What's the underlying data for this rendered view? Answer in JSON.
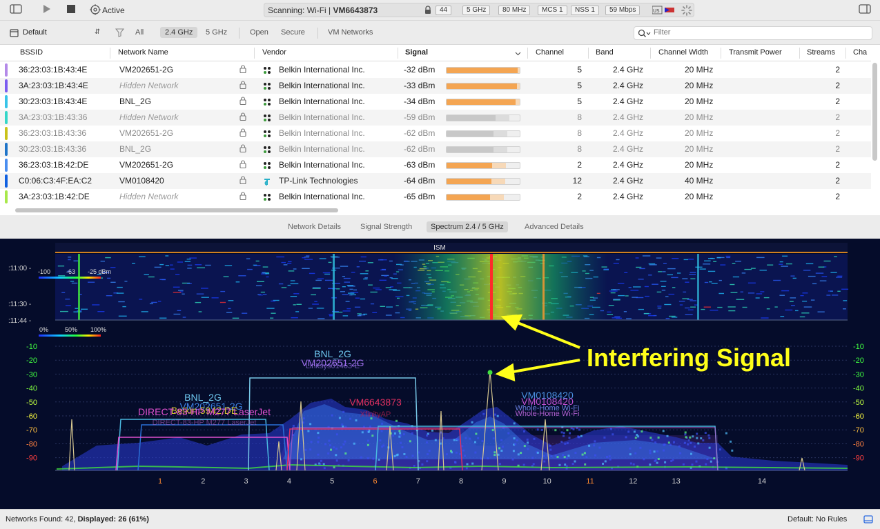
{
  "toolbar": {
    "status_label": "Active",
    "scan_prefix": "Scanning: Wi-Fi  |  ",
    "scan_network": "VM6643873",
    "pills": [
      "44",
      "5 GHz",
      "80 MHz",
      "MCS 1",
      "NSS 1",
      "59 Mbps"
    ]
  },
  "filterbar": {
    "profile": "Default",
    "filters": [
      "All",
      "2.4 GHz",
      "5 GHz",
      "Open",
      "Secure",
      "VM Networks"
    ],
    "selected_filter": "2.4 GHz",
    "search_placeholder": "Filter"
  },
  "table": {
    "columns": [
      "BSSID",
      "Network Name",
      "Vendor",
      "Signal",
      "Channel",
      "Band",
      "Channel Width",
      "Transmit Power",
      "Streams",
      "Cha"
    ],
    "rows": [
      {
        "tag_color": "#b48ae8",
        "bssid": "36:23:03:1B:43:4E",
        "name": "VM202651-2G",
        "hidden": false,
        "vendor": "Belkin International Inc.",
        "vendor_icon": "belkin-icon",
        "signal": "-32 dBm",
        "signal_pct": 95,
        "channel": "5",
        "band": "2.4 GHz",
        "width": "20 MHz",
        "streams": "2",
        "dim": false
      },
      {
        "tag_color": "#7b5cf0",
        "bssid": "3A:23:03:1B:43:4E",
        "name": "Hidden Network",
        "hidden": true,
        "vendor": "Belkin International Inc.",
        "vendor_icon": "belkin-icon",
        "signal": "-33 dBm",
        "signal_pct": 94,
        "channel": "5",
        "band": "2.4 GHz",
        "width": "20 MHz",
        "streams": "2",
        "dim": false
      },
      {
        "tag_color": "#38c4e8",
        "bssid": "30:23:03:1B:43:4E",
        "name": "BNL_2G",
        "hidden": false,
        "vendor": "Belkin International Inc.",
        "vendor_icon": "belkin-icon",
        "signal": "-34 dBm",
        "signal_pct": 93,
        "channel": "5",
        "band": "2.4 GHz",
        "width": "20 MHz",
        "streams": "2",
        "dim": false
      },
      {
        "tag_color": "#34d6c8",
        "bssid": "3A:23:03:1B:43:36",
        "name": "Hidden Network",
        "hidden": true,
        "vendor": "Belkin International Inc.",
        "vendor_icon": "belkin-icon",
        "signal": "-59 dBm",
        "signal_pct": 66,
        "channel": "8",
        "band": "2.4 GHz",
        "width": "20 MHz",
        "streams": "2",
        "dim": true
      },
      {
        "tag_color": "#c9c21a",
        "bssid": "36:23:03:1B:43:36",
        "name": "VM202651-2G",
        "hidden": false,
        "vendor": "Belkin International Inc.",
        "vendor_icon": "belkin-icon",
        "signal": "-62 dBm",
        "signal_pct": 63,
        "channel": "8",
        "band": "2.4 GHz",
        "width": "20 MHz",
        "streams": "2",
        "dim": true
      },
      {
        "tag_color": "#1e74c8",
        "bssid": "30:23:03:1B:43:36",
        "name": "BNL_2G",
        "hidden": false,
        "vendor": "Belkin International Inc.",
        "vendor_icon": "belkin-icon",
        "signal": "-62 dBm",
        "signal_pct": 63,
        "channel": "8",
        "band": "2.4 GHz",
        "width": "20 MHz",
        "streams": "2",
        "dim": true
      },
      {
        "tag_color": "#4a8ef0",
        "bssid": "36:23:03:1B:42:DE",
        "name": "VM202651-2G",
        "hidden": false,
        "vendor": "Belkin International Inc.",
        "vendor_icon": "belkin-icon",
        "signal": "-63 dBm",
        "signal_pct": 61,
        "channel": "2",
        "band": "2.4 GHz",
        "width": "20 MHz",
        "streams": "2",
        "dim": false
      },
      {
        "tag_color": "#1060e0",
        "bssid": "C0:06:C3:4F:EA:C2",
        "name": "VM0108420",
        "hidden": false,
        "vendor": "TP-Link Technologies",
        "vendor_icon": "tplink-icon",
        "signal": "-64 dBm",
        "signal_pct": 60,
        "channel": "12",
        "band": "2.4 GHz",
        "width": "40 MHz",
        "streams": "2",
        "dim": false
      },
      {
        "tag_color": "#a8e84a",
        "bssid": "3A:23:03:1B:42:DE",
        "name": "Hidden Network",
        "hidden": true,
        "vendor": "Belkin International Inc.",
        "vendor_icon": "belkin-icon",
        "signal": "-65 dBm",
        "signal_pct": 58,
        "channel": "2",
        "band": "2.4 GHz",
        "width": "20 MHz",
        "streams": "2",
        "dim": false
      }
    ]
  },
  "tabs": [
    "Network Details",
    "Signal Strength",
    "Spectrum 2.4 / 5 GHz",
    "Advanced Details"
  ],
  "selected_tab": "Spectrum 2.4 / 5 GHz",
  "spectrum": {
    "band_label": "ISM",
    "waterfall_times": [
      ":11:00 -",
      ":11:30 -",
      ":11:44 -"
    ],
    "dbm_legend": [
      "-100",
      "-63",
      "-25 dBm"
    ],
    "pct_legend": [
      "0%",
      "50%",
      "100%"
    ],
    "y_ticks": [
      "-10",
      "-20",
      "-30",
      "-40",
      "-50",
      "-60",
      "-70",
      "-80",
      "-90"
    ],
    "x_ticks": [
      "1",
      "2",
      "3",
      "4",
      "5",
      "6",
      "7",
      "8",
      "9",
      "10",
      "11",
      "12",
      "13",
      "14"
    ],
    "highlighted_channels": [
      "1",
      "6",
      "11"
    ],
    "network_labels": {
      "bnl_top": "BNL_2G",
      "vm_top": "VM202651-2G",
      "linksys": "Linksys01463-E",
      "bnl_left": "BNL_2G",
      "vm_left": "VM202651-2G",
      "belkin": "Belkin.5942.DE",
      "direct": "DIRECT-83-HP M277 LaserJet",
      "direct2": "DIRECT-83-HP M277 LaserJet",
      "vm6643": "VM6643873",
      "xfinity": "XfinityAP",
      "vm0108_a": "VM0108420",
      "vm0108_b": "VM0108420",
      "whole_a": "Whole-Home Wi-Fi",
      "whole_b": "Whole-Home Wi-Fi"
    },
    "annotation": "Interfering Signal"
  },
  "status": {
    "networks_found": "Networks Found: 42, ",
    "displayed": "Displayed: 26 (61%)",
    "rules": "Default: No Rules"
  }
}
